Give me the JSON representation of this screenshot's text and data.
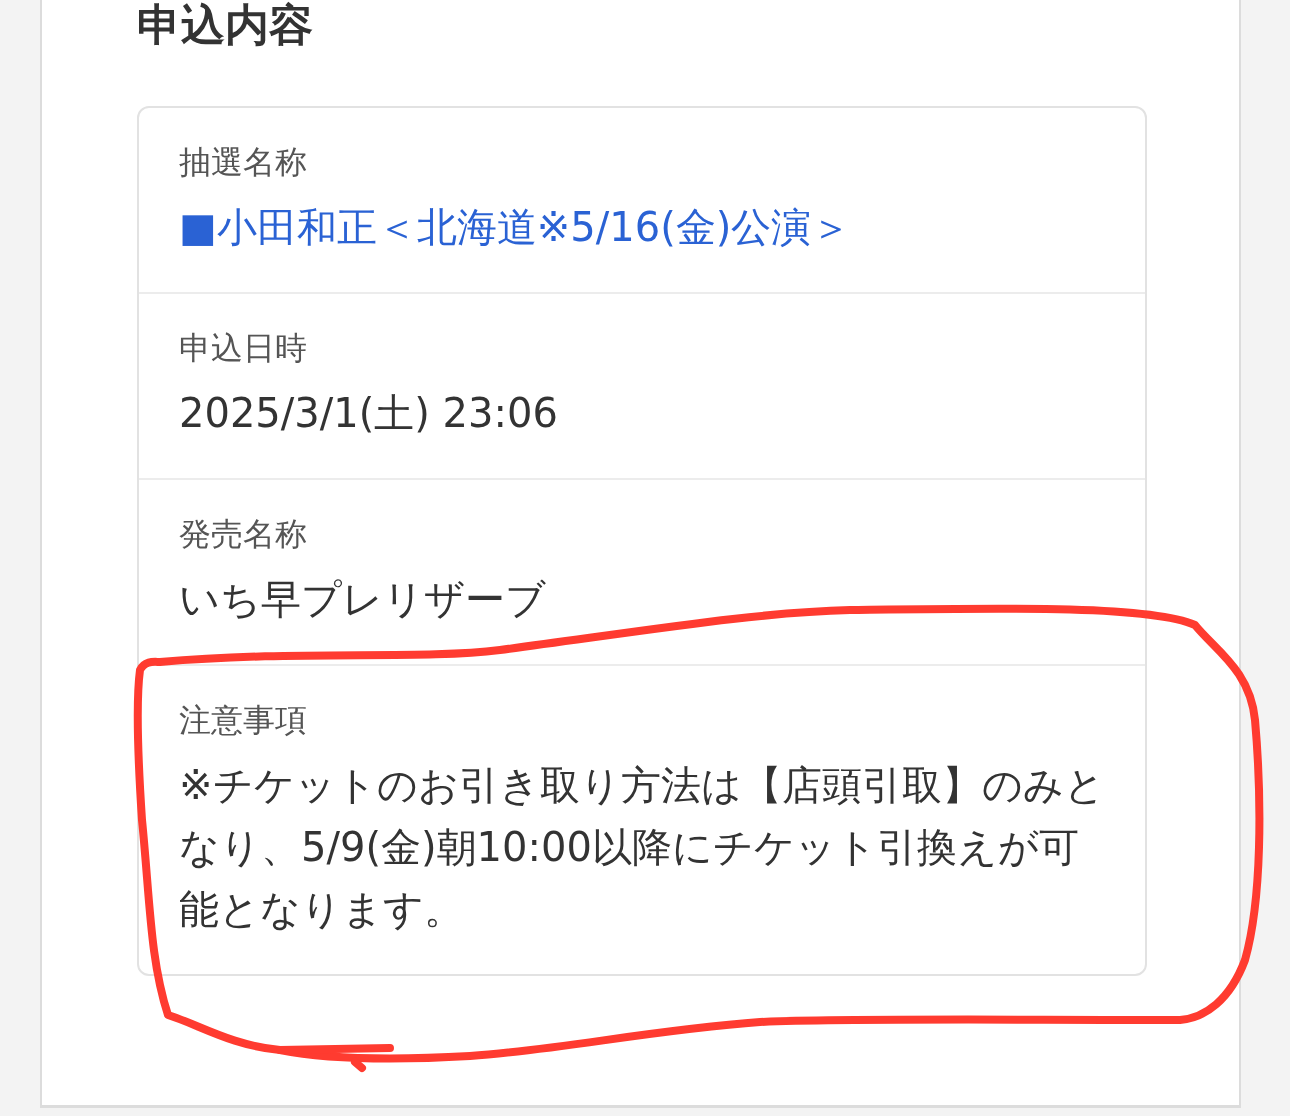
{
  "section_title": "申込内容",
  "fields": [
    {
      "label": "抽選名称",
      "value": "■小田和正＜北海道※5/16(金)公演＞",
      "kind": "link"
    },
    {
      "label": "申込日時",
      "value": "2025/3/1(土) 23:06",
      "kind": "text"
    },
    {
      "label": "発売名称",
      "value": "いち早プレリザーブ",
      "kind": "text"
    },
    {
      "label": "注意事項",
      "value": "※チケットのお引き取り方法は【店頭引取】のみとなり、5/9(金)朝10:00以降にチケット引換えが可能となります。",
      "kind": "text"
    }
  ]
}
